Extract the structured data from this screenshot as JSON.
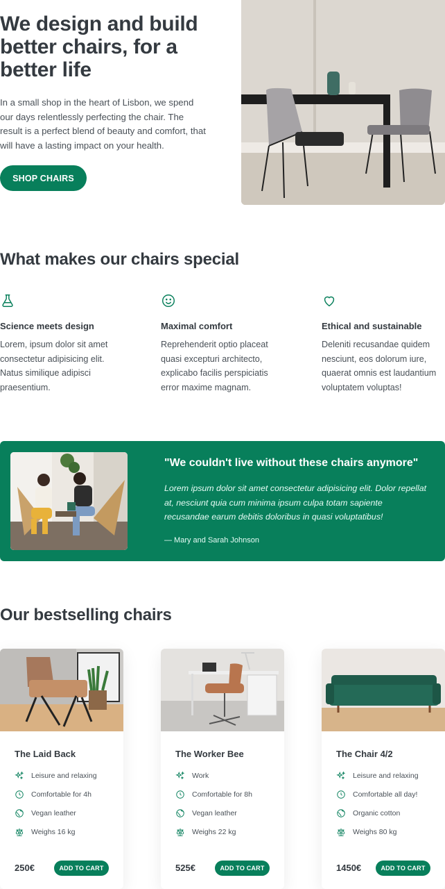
{
  "hero": {
    "title": "We design and build better chairs, for a better life",
    "description": "In a small shop in the heart of Lisbon, we spend our days relentlessly perfecting the chair. The result is a perfect blend of beauty and comfort, that will have a lasting impact on your health.",
    "cta_label": "SHOP CHAIRS"
  },
  "features": {
    "title": "What makes our chairs special",
    "items": [
      {
        "icon": "flask-icon",
        "title": "Science meets design",
        "text": "Lorem, ipsum dolor sit amet consectetur adipisicing elit. Natus similique adipisci praesentium."
      },
      {
        "icon": "smiley-icon",
        "title": "Maximal comfort",
        "text": "Reprehenderit optio placeat quasi excepturi architecto, explicabo facilis perspiciatis error maxime magnam."
      },
      {
        "icon": "heart-icon",
        "title": "Ethical and sustainable",
        "text": "Deleniti recusandae quidem nesciunt, eos dolorum iure, quaerat omnis est laudantium voluptatem voluptas!"
      }
    ]
  },
  "testimonial": {
    "quote": "\"We couldn't live without these chairs anymore\"",
    "text": "Lorem ipsum dolor sit amet consectetur adipisicing elit. Dolor repellat at, nesciunt quia cum minima ipsum culpa totam sapiente recusandae earum debitis doloribus in quasi voluptatibus!",
    "author": "— Mary and Sarah Johnson"
  },
  "products": {
    "title": "Our bestselling chairs",
    "items": [
      {
        "name": "The Laid Back",
        "attrs": [
          "Leisure and relaxing",
          "Comfortable for 4h",
          "Vegan leather",
          "Weighs 16 kg"
        ],
        "price": "250€",
        "cart_label": "ADD TO CART"
      },
      {
        "name": "The Worker Bee",
        "attrs": [
          "Work",
          "Comfortable for 8h",
          "Vegan leather",
          "Weighs 22 kg"
        ],
        "price": "525€",
        "cart_label": "ADD TO CART"
      },
      {
        "name": "The Chair 4/2",
        "attrs": [
          "Leisure and relaxing",
          "Comfortable all day!",
          "Organic cotton",
          "Weighs 80 kg"
        ],
        "price": "1450€",
        "cart_label": "ADD TO CART"
      }
    ]
  },
  "colors": {
    "accent": "#087f5b",
    "text": "#343a40",
    "muted": "#495057"
  }
}
